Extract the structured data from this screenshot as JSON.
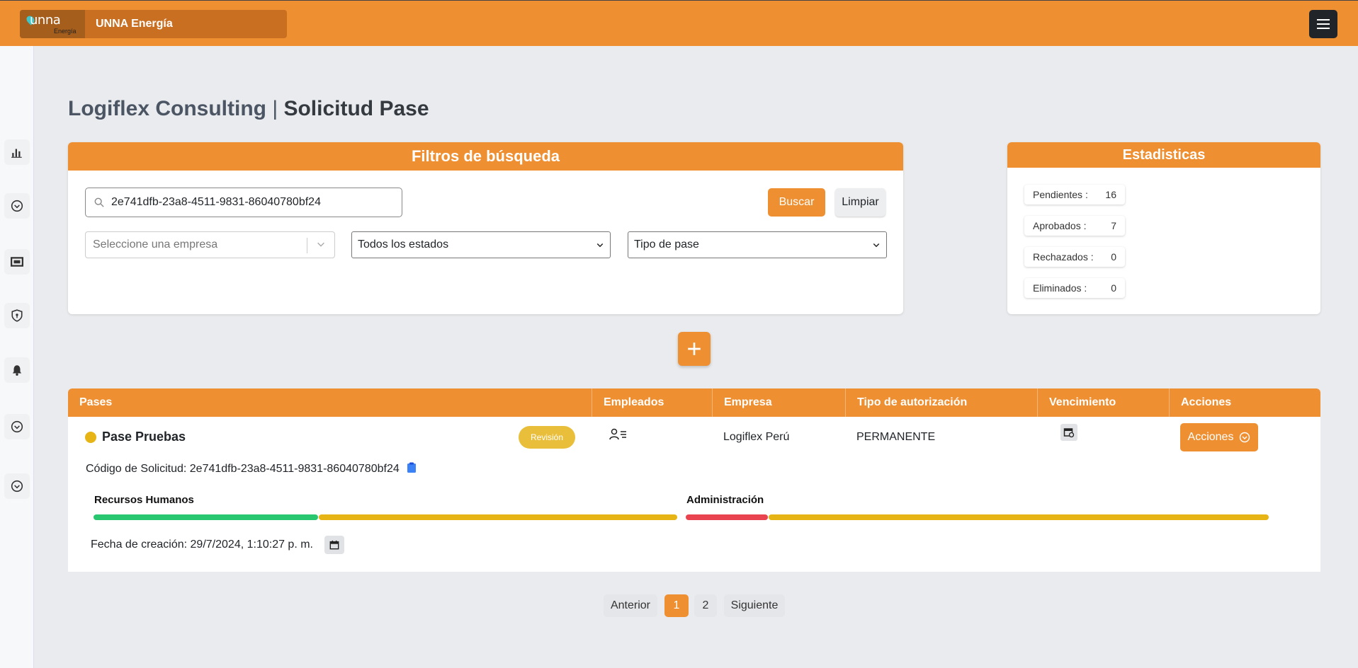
{
  "header": {
    "brand_logo_text": "unna",
    "brand_logo_sub": "Energía",
    "brand_name": "UNNA Energía"
  },
  "sidebar": {
    "icons": [
      "bar-chart-icon",
      "chevron-circle-down-icon",
      "vehicle-icon",
      "shield-icon",
      "bell-icon",
      "chevron-circle-down-icon",
      "chevron-circle-down-icon"
    ]
  },
  "page": {
    "company": "Logiflex Consulting",
    "separator": "|",
    "section": "Solicitud Pase"
  },
  "filters": {
    "title": "Filtros de búsqueda",
    "search_value": "2e741dfb-23a8-4511-9831-86040780bf24",
    "search_label": "Buscar",
    "clear_label": "Limpiar",
    "company_placeholder": "Seleccione una empresa",
    "status_selected": "Todos los estados",
    "type_selected": "Tipo de pase"
  },
  "stats": {
    "title": "Estadisticas",
    "items": [
      {
        "label": "Pendientes :",
        "value": "16"
      },
      {
        "label": "Aprobados :",
        "value": "7"
      },
      {
        "label": "Rechazados :",
        "value": "0"
      },
      {
        "label": "Eliminados :",
        "value": "0"
      }
    ]
  },
  "table": {
    "headers": [
      "Pases",
      "Empleados",
      "Empresa",
      "Tipo de autorización",
      "Vencimiento",
      "Acciones"
    ],
    "row": {
      "name": "Pase Pruebas",
      "status_color": "#e7b416",
      "badge": "Revisión",
      "empresa": "Logiflex Perú",
      "tipo": "PERMANENTE",
      "actions_label": "Acciones",
      "code_label": "Código de Solicitud:",
      "code_value": "2e741dfb-23a8-4511-9831-86040780bf24",
      "departments": [
        {
          "name": "Recursos Humanos",
          "approved_fraction": 0.385,
          "approved_color": "#28c76f",
          "pending_color": "#e7b416"
        },
        {
          "name": "Administración",
          "rejected_fraction": 0.14,
          "rejected_color": "#e8434e",
          "pending_color": "#e7b416"
        }
      ],
      "created_label": "Fecha de creación:",
      "created_value": "29/7/2024, 1:10:27 p. m."
    }
  },
  "pagination": {
    "prev": "Anterior",
    "pages": [
      "1",
      "2"
    ],
    "active": "1",
    "next": "Siguiente"
  },
  "colors": {
    "accent": "#ee8f31",
    "dark": "#212529"
  }
}
